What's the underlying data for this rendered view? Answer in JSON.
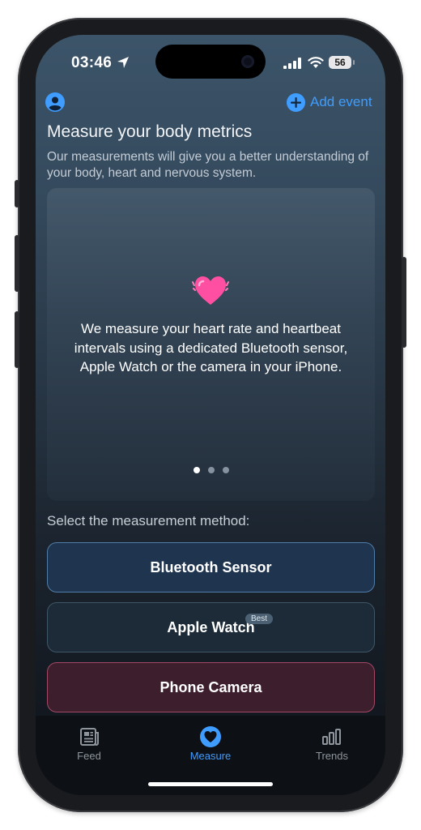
{
  "status_bar": {
    "time": "03:46",
    "battery": "56"
  },
  "header": {
    "add_event_label": "Add event"
  },
  "intro": {
    "title": "Measure your body metrics",
    "subtitle": "Our measurements will give you a better understanding of your body, heart and nervous system."
  },
  "card": {
    "text": "We measure your heart rate and heartbeat intervals using a dedicated Bluetooth sensor, Apple Watch or the camera in your iPhone.",
    "page_count": 3,
    "active_page": 1
  },
  "methods": {
    "label": "Select the measurement method:",
    "items": [
      {
        "label": "Bluetooth Sensor"
      },
      {
        "label": "Apple Watch",
        "badge": "Best"
      },
      {
        "label": "Phone Camera"
      }
    ]
  },
  "tabs": [
    {
      "label": "Feed",
      "icon": "feed-icon"
    },
    {
      "label": "Measure",
      "icon": "heart-icon",
      "active": true
    },
    {
      "label": "Trends",
      "icon": "bars-icon"
    }
  ],
  "colors": {
    "accent": "#3f9dff",
    "bluetooth_border": "#4e7ea9",
    "camera_border": "#a44865",
    "heart": "#ff4fa3"
  }
}
